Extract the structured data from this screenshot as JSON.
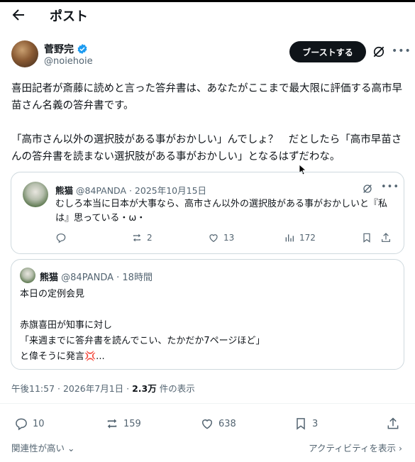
{
  "header": {
    "title": "ポスト"
  },
  "author": {
    "name": "菅野完",
    "handle": "@noiehoie"
  },
  "boost_label": "ブーストする",
  "post": {
    "paragraphs": [
      "喜田記者が斎藤に読めと言った答弁書は、あなたがここまで最大限に評価する高市早苗さん名義の答弁書です。",
      "「高市さん以外の選択肢がある事がおかしい」んでしょ？　だとしたら「高市早苗さんの答弁書を読まない選択肢がある事がおかしい」となるはずだわな。"
    ]
  },
  "quote1": {
    "name": "熊猫",
    "meta": "@84PANDA · 2025年10月15日",
    "text": "むしろ本当に日本が大事なら、高市さん以外の選択肢がある事がおかしいと『私は』思っている・ω・",
    "replies": "",
    "reposts": "2",
    "likes": "13",
    "views": "172"
  },
  "quote2": {
    "name": "熊猫",
    "meta": "@84PANDA · 18時間",
    "lines": [
      "本日の定例会見",
      "",
      "赤旗喜田が知事に対し",
      "「来週までに答弁書を読んでこい、たかだか7ページほど」",
      "と偉そうに発言💢..."
    ]
  },
  "timestamp": {
    "time": "午後11:57 · 2026年7月1日 · ",
    "views": "2.3万",
    "suffix": " 件の表示"
  },
  "stats": {
    "replies": "10",
    "reposts": "159",
    "likes": "638",
    "bookmarks": "3"
  },
  "footer": {
    "relevance": "関連性が高い",
    "activity": "アクティビティを表示"
  },
  "colors": {
    "text": "#0f1419",
    "muted": "#536471",
    "border": "#cfd9de",
    "verified": "#1d9bf0"
  }
}
